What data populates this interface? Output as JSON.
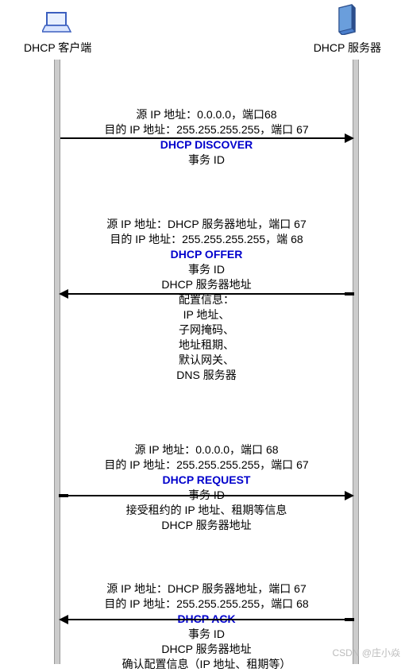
{
  "chart_data": {
    "type": "sequence-diagram",
    "participants": [
      "DHCP 客户端",
      "DHCP 服务器"
    ],
    "messages": [
      {
        "from": "DHCP 客户端",
        "to": "DHCP 服务器",
        "name": "DHCP DISCOVER",
        "src_ip": "0.0.0.0",
        "src_port": 68,
        "dst_ip": "255.255.255.255",
        "dst_port": 67,
        "payload": [
          "事务 ID"
        ]
      },
      {
        "from": "DHCP 服务器",
        "to": "DHCP 客户端",
        "name": "DHCP OFFER",
        "src_ip": "DHCP 服务器地址",
        "src_port": 67,
        "dst_ip": "255.255.255.255",
        "dst_port": 68,
        "payload": [
          "事务 ID",
          "DHCP 服务器地址",
          "配置信息：",
          "IP 地址、",
          "子网掩码、",
          "地址租期、",
          "默认网关、",
          "DNS 服务器"
        ]
      },
      {
        "from": "DHCP 客户端",
        "to": "DHCP 服务器",
        "name": "DHCP REQUEST",
        "src_ip": "0.0.0.0",
        "src_port": 68,
        "dst_ip": "255.255.255.255",
        "dst_port": 67,
        "payload": [
          "事务 ID",
          "接受租约的 IP 地址、租期等信息",
          "DHCP 服务器地址"
        ]
      },
      {
        "from": "DHCP 服务器",
        "to": "DHCP 客户端",
        "name": "DHCP ACK",
        "src_ip": "DHCP 服务器地址",
        "src_port": 67,
        "dst_ip": "255.255.255.255",
        "dst_port": 68,
        "payload": [
          "事务 ID",
          "DHCP 服务器地址",
          "确认配置信息（IP 地址、租期等）"
        ]
      }
    ]
  },
  "client_label": "DHCP 客户端",
  "server_label": "DHCP 服务器",
  "m1": {
    "src": "源 IP 地址：0.0.0.0，端口68",
    "dst": "目的 IP 地址：255.255.255.255，端口 67",
    "title": "DHCP DISCOVER",
    "l1": "事务 ID"
  },
  "m2": {
    "src": "源 IP 地址：DHCP 服务器地址，端口 67",
    "dst": "目的 IP 地址：255.255.255.255，端 68",
    "title": "DHCP OFFER",
    "l1": "事务 ID",
    "l2": "DHCP 服务器地址",
    "l3": "配置信息：",
    "l4": "IP 地址、",
    "l5": "子网掩码、",
    "l6": "地址租期、",
    "l7": "默认网关、",
    "l8": "DNS 服务器"
  },
  "m3": {
    "src": "源 IP 地址：0.0.0.0，端口 68",
    "dst": "目的 IP 地址：255.255.255.255，端口 67",
    "title": "DHCP REQUEST",
    "l1": "事务 ID",
    "l2": "接受租约的 IP 地址、租期等信息",
    "l3": "DHCP 服务器地址"
  },
  "m4": {
    "src": "源 IP 地址：DHCP 服务器地址，端口 67",
    "dst": "目的 IP 地址：255.255.255.255，端口 68",
    "title": "DHCP ACK",
    "l1": "事务 ID",
    "l2": "DHCP 服务器地址",
    "l3": "确认配置信息（IP 地址、租期等）"
  },
  "watermark": "CSDN @庄小焱"
}
